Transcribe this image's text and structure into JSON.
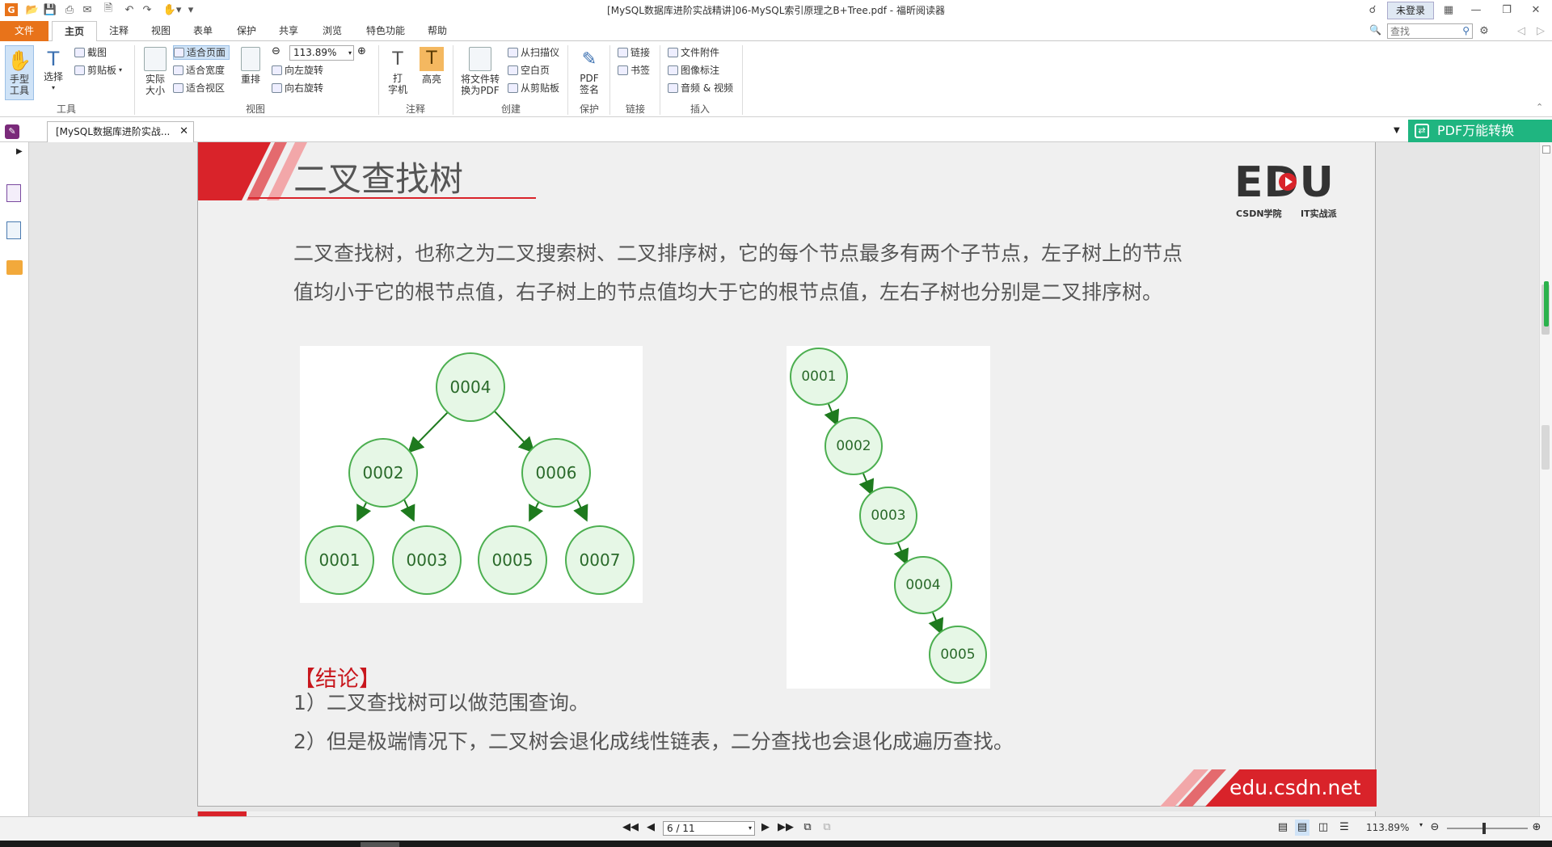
{
  "window": {
    "title": "[MySQL数据库进阶实战精讲]06-MySQL索引原理之B+Tree.pdf - 福昕阅读器",
    "login_label": "未登录",
    "search_placeholder": "查找"
  },
  "menu_tabs": [
    "文件",
    "主页",
    "注释",
    "视图",
    "表单",
    "保护",
    "共享",
    "浏览",
    "特色功能",
    "帮助"
  ],
  "ribbon": {
    "tools": {
      "hand": "手型\n工具",
      "select": "选择",
      "screenshot": "截图",
      "clipboard": "剪贴板",
      "group": "工具"
    },
    "view": {
      "actual_size": "实际\n大小",
      "fit_page": "适合页面",
      "fit_width": "适合宽度",
      "fit_visible": "适合视区",
      "reflow": "重排",
      "zoom_value": "113.89%",
      "rotate_left": "向左旋转",
      "rotate_right": "向右旋转",
      "group": "视图"
    },
    "comment": {
      "typewriter": "打\n字机",
      "highlight": "高亮",
      "group": "注释"
    },
    "create": {
      "convert": "将文件转\n换为PDF",
      "from_scanner": "从扫描仪",
      "blank_page": "空白页",
      "from_clipboard": "从剪贴板",
      "group": "创建"
    },
    "protect": {
      "pdf_sign": "PDF\n签名",
      "group": "保护"
    },
    "links": {
      "link": "链接",
      "bookmark": "书签",
      "group": "链接"
    },
    "insert": {
      "file_attachment": "文件附件",
      "image_annotation": "图像标注",
      "audio_video": "音频 & 视频",
      "group": "插入"
    }
  },
  "doc_tab": {
    "label": "[MySQL数据库进阶实战...",
    "pdf_convert": "PDF万能转换"
  },
  "page": {
    "title": "二叉查找树",
    "logo_main": "EDU",
    "logo_sub_left": "CSDN学院",
    "logo_sub_right": "IT实战派",
    "paragraph_line1": "二叉查找树，也称之为二叉搜索树、二叉排序树，它的每个节点最多有两个子节点，左子树上的节点",
    "paragraph_line2": "值均小于它的根节点值，右子树上的节点值均大于它的根节点值，左右子树也分别是二叉排序树。",
    "conclusion_title": "【结论】",
    "conclusion_1": "1）二叉查找树可以做范围查询。",
    "conclusion_2": "2）但是极端情况下，二叉树会退化成线性链表，二分查找也会退化成遍历查找。",
    "footer_url": "edu.csdn.net",
    "balanced_tree": [
      "0004",
      "0002",
      "0006",
      "0001",
      "0003",
      "0005",
      "0007"
    ],
    "skewed_tree": [
      "0001",
      "0002",
      "0003",
      "0004",
      "0005"
    ]
  },
  "status": {
    "page_indicator": "6 / 11",
    "zoom": "113.89%"
  },
  "colors": {
    "accent_orange": "#e8731a",
    "brand_red": "#d9232a",
    "node_green": "#4caf50",
    "pdf_convert_green": "#1fb580"
  }
}
